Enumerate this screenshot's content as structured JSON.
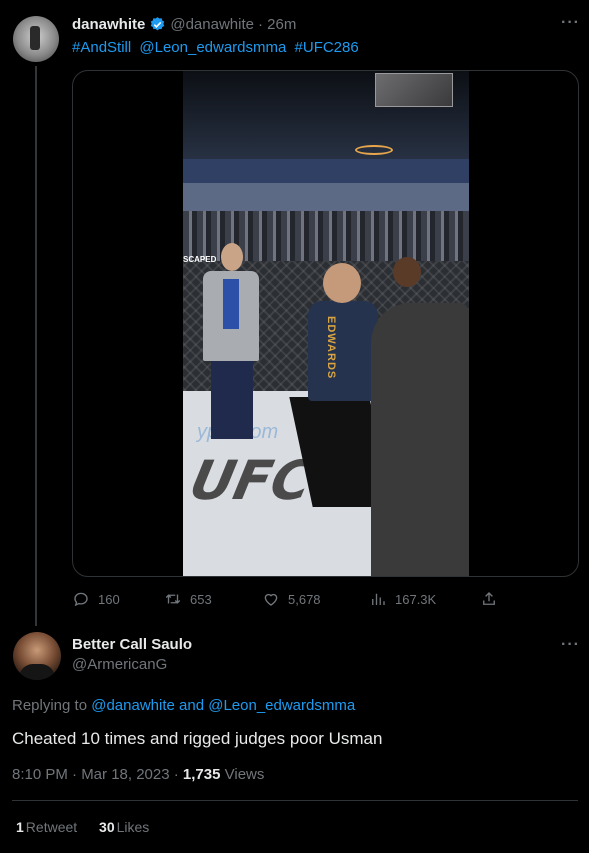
{
  "tweet": {
    "name": "danawhite",
    "handle": "@danawhite",
    "time": "· 26m",
    "hashtags": [
      "#AndStill",
      "@Leon_edwardsmma",
      "#UFC286"
    ],
    "video_overlay": {
      "jersey_text": "EDWARDS",
      "banner_text": "SCAPED",
      "floor_logo": "UFC",
      "floor_sponsor": "ypto.com"
    },
    "actions": {
      "replies": "160",
      "retweets": "653",
      "likes": "5,678",
      "views": "167.3K"
    }
  },
  "reply": {
    "name": "Better Call Saulo",
    "handle": "@ArmericanG",
    "replying_prefix": "Replying to",
    "replying_user1": "@danawhite",
    "replying_and": "and",
    "replying_user2": "@Leon_edwardsmma",
    "text": "Cheated 10 times and rigged judges poor Usman",
    "time": "8:10 PM · Mar 18, 2023 ·",
    "views_count": "1,735",
    "views_label": "Views",
    "retweets_count": "1",
    "retweets_label": "Retweet",
    "likes_count": "30",
    "likes_label": "Likes"
  },
  "more_label": "···",
  "colors": {
    "accent": "#1d9bf0",
    "muted": "#71767b",
    "text": "#e7e9ea",
    "bg": "#000000"
  }
}
